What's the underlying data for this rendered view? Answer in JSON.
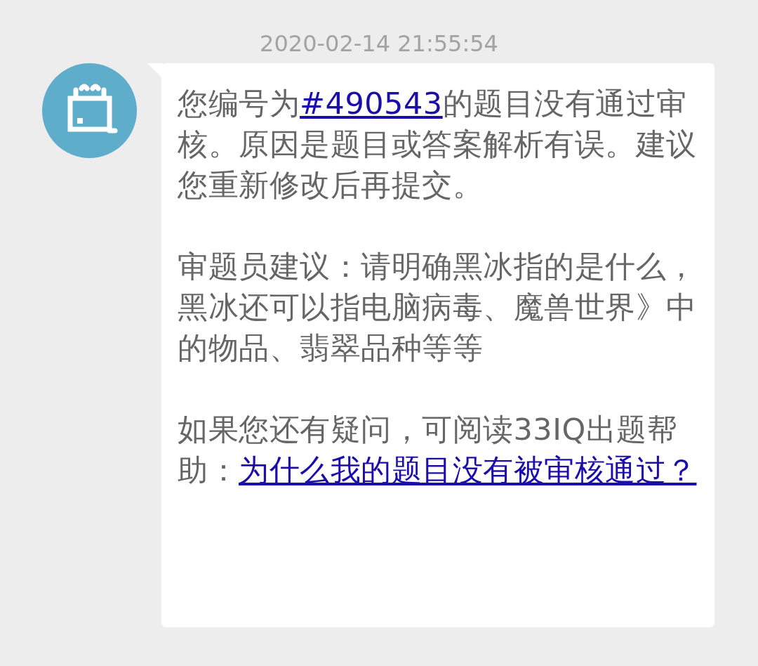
{
  "timestamp": "2020-02-14 21:55:54",
  "message": {
    "paragraphs": [
      {
        "segments": [
          {
            "kind": "text",
            "text": "您编号为"
          },
          {
            "kind": "link",
            "text": "#490543"
          },
          {
            "kind": "text",
            "text": "的题目没有通过审核。原因是题目或答案解析有误。建议您重新修改后再提交。"
          }
        ]
      },
      {
        "segments": [
          {
            "kind": "text",
            "text": "审题员建议：请明确黑冰指的是什么，黑冰还可以指电脑病毒、魔兽世界》中的物品、翡翠品种等等"
          }
        ]
      },
      {
        "segments": [
          {
            "kind": "text",
            "text": "如果您还有疑问，可阅读33IQ出题帮助："
          },
          {
            "kind": "link",
            "text": "为什么我的题目没有被审核通过？"
          }
        ]
      }
    ]
  }
}
